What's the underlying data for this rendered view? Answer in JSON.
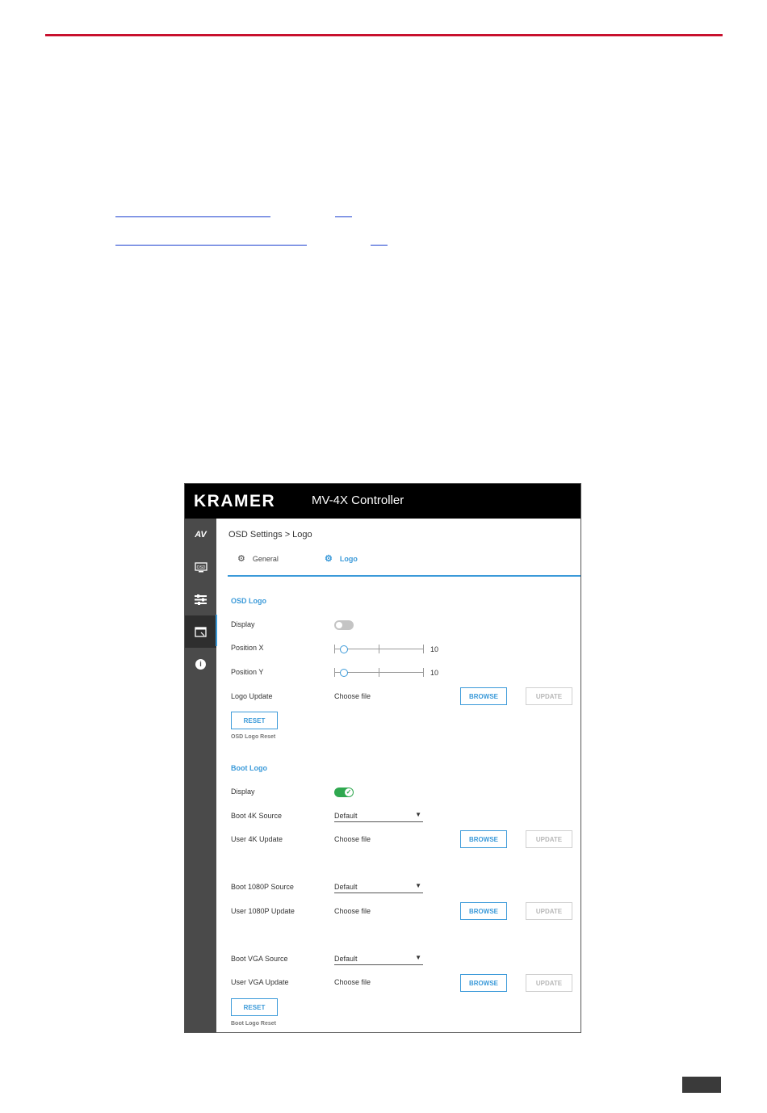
{
  "header": {
    "accent_color": "#c8102e"
  },
  "app": {
    "brand": "KRAMER",
    "title": "MV-4X Controller"
  },
  "sidebar": {
    "items": [
      {
        "name": "av",
        "label": "AV"
      },
      {
        "name": "osd",
        "label": "OSD"
      },
      {
        "name": "settings",
        "label": ""
      },
      {
        "name": "logo",
        "label": ""
      },
      {
        "name": "info",
        "label": "i"
      }
    ]
  },
  "breadcrumb": "OSD Settings > Logo",
  "tabs": [
    {
      "label": "General",
      "active": false
    },
    {
      "label": "Logo",
      "active": true
    }
  ],
  "osd_logo": {
    "title": "OSD Logo",
    "display_label": "Display",
    "display_on": false,
    "position_x_label": "Position X",
    "position_x_value": "10",
    "position_y_label": "Position Y",
    "position_y_value": "10",
    "logo_update_label": "Logo Update",
    "choose_file": "Choose file",
    "browse": "BROWSE",
    "update": "UPDATE",
    "reset": "RESET",
    "reset_caption": "OSD Logo Reset"
  },
  "boot_logo": {
    "title": "Boot Logo",
    "display_label": "Display",
    "display_on": true,
    "boot4k_label": "Boot 4K Source",
    "boot4k_value": "Default",
    "user4k_label": "User 4K Update",
    "boot1080_label": "Boot 1080P Source",
    "boot1080_value": "Default",
    "user1080_label": "User 1080P Update",
    "bootvga_label": "Boot VGA Source",
    "bootvga_value": "Default",
    "uservga_label": "User VGA Update",
    "choose_file": "Choose file",
    "browse": "BROWSE",
    "update": "UPDATE",
    "reset": "RESET",
    "reset_caption": "Boot Logo Reset"
  }
}
